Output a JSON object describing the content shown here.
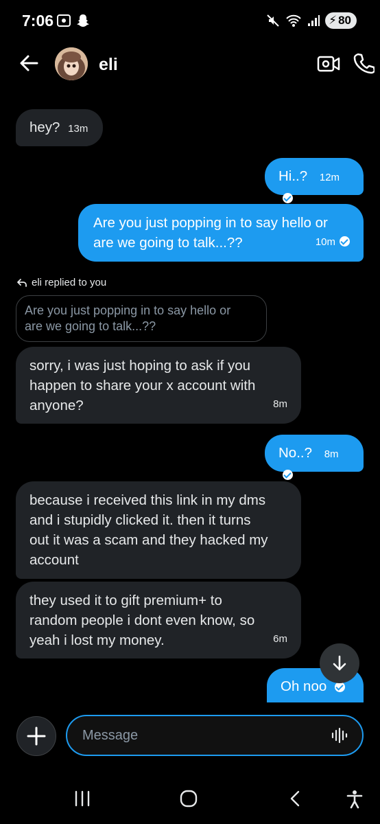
{
  "status_bar": {
    "time": "7:06",
    "battery": "80"
  },
  "header": {
    "contact_name": "eli"
  },
  "messages": [
    {
      "direction": "in",
      "text": "hey?",
      "time": "13m"
    },
    {
      "direction": "out",
      "text": "Hi..?",
      "time": "12m"
    },
    {
      "direction": "out",
      "lines": [
        "Are you just popping in to say hello or",
        "are we going to talk...??"
      ],
      "time": "10m"
    },
    {
      "direction": "in",
      "reply_label": "eli replied to you",
      "quoted_lines": [
        "Are you just popping in to say hello or",
        "are we going to talk...??"
      ],
      "lines": [
        "sorry, i was just hoping to ask if you",
        "happen to share your x account with",
        "anyone?"
      ],
      "time": "8m"
    },
    {
      "direction": "out",
      "text": "No..?",
      "time": "8m"
    },
    {
      "direction": "in",
      "lines": [
        "because i received this link in my dms",
        "and i stupidly clicked it. then it turns",
        "out it was a scam and they hacked my",
        "account"
      ]
    },
    {
      "direction": "in",
      "lines": [
        "they used it to gift premium+ to",
        "random people i dont even know, so",
        "yeah i lost my money."
      ],
      "time": "6m"
    },
    {
      "direction": "out",
      "text": "Oh noo"
    }
  ],
  "composer": {
    "placeholder": "Message"
  },
  "icons": {
    "back": "arrow-left-icon",
    "video": "video-camera-icon",
    "call": "phone-icon",
    "scroll_down": "arrow-down-icon",
    "add": "plus-icon",
    "voice": "voice-wave-icon",
    "reply": "reply-arrow-icon"
  },
  "colors": {
    "accent": "#1d9bf0",
    "incoming_bubble": "#202327",
    "background": "#000000"
  }
}
